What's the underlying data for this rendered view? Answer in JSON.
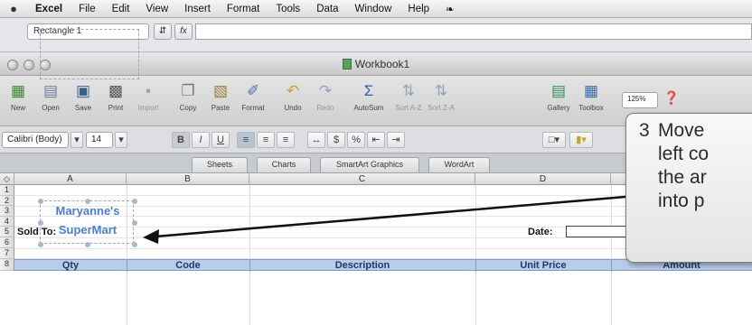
{
  "menubar": {
    "app": "Excel",
    "items": [
      "File",
      "Edit",
      "View",
      "Insert",
      "Format",
      "Tools",
      "Data",
      "Window",
      "Help"
    ]
  },
  "formula_bar": {
    "name_box": "Rectangle 1",
    "fx_label": "fx",
    "formula": ""
  },
  "window": {
    "title": "Workbook1"
  },
  "toolbar": {
    "buttons": [
      {
        "label": "New",
        "icon": "new-icon"
      },
      {
        "label": "Open",
        "icon": "open-icon"
      },
      {
        "label": "Save",
        "icon": "save-icon"
      },
      {
        "label": "Print",
        "icon": "print-icon"
      },
      {
        "label": "Import",
        "icon": "import-icon"
      },
      {
        "label": "Copy",
        "icon": "copy-icon"
      },
      {
        "label": "Paste",
        "icon": "paste-icon"
      },
      {
        "label": "Format",
        "icon": "format-painter-icon"
      },
      {
        "label": "Undo",
        "icon": "undo-icon"
      },
      {
        "label": "Redo",
        "icon": "redo-icon"
      },
      {
        "label": "AutoSum",
        "icon": "autosum-icon"
      },
      {
        "label": "Sort A-Z",
        "icon": "sort-az-icon"
      },
      {
        "label": "Sort Z-A",
        "icon": "sort-za-icon"
      },
      {
        "label": "Gallery",
        "icon": "gallery-icon"
      },
      {
        "label": "Toolbox",
        "icon": "toolbox-icon"
      }
    ],
    "zoom": "125%",
    "help_icon": "help-icon"
  },
  "format_bar": {
    "font": "Calibri (Body)",
    "size": "14",
    "bold": "B",
    "italic": "I",
    "underline": "U"
  },
  "gallery_tabs": [
    "Sheets",
    "Charts",
    "SmartArt Graphics",
    "WordArt"
  ],
  "sheet": {
    "columns": [
      "A",
      "B",
      "C",
      "D"
    ],
    "rows": [
      "1",
      "2",
      "3",
      "4",
      "5",
      "6",
      "7",
      "8"
    ],
    "logo_line1": "Maryanne's",
    "logo_line2": "SuperMart",
    "sold_to": "Sold To:",
    "date": "Date:",
    "table_headers": [
      "Qty",
      "Code",
      "Description",
      "Unit Price",
      "Amount"
    ]
  },
  "callout": {
    "number": "3",
    "line1": "Move",
    "line2": "left co",
    "line3": "the ar",
    "line4": "into p"
  },
  "colors": {
    "logo_blue": "#4a7fc9",
    "table_header_bg": "#b9cde8",
    "arrow": "#111111"
  }
}
